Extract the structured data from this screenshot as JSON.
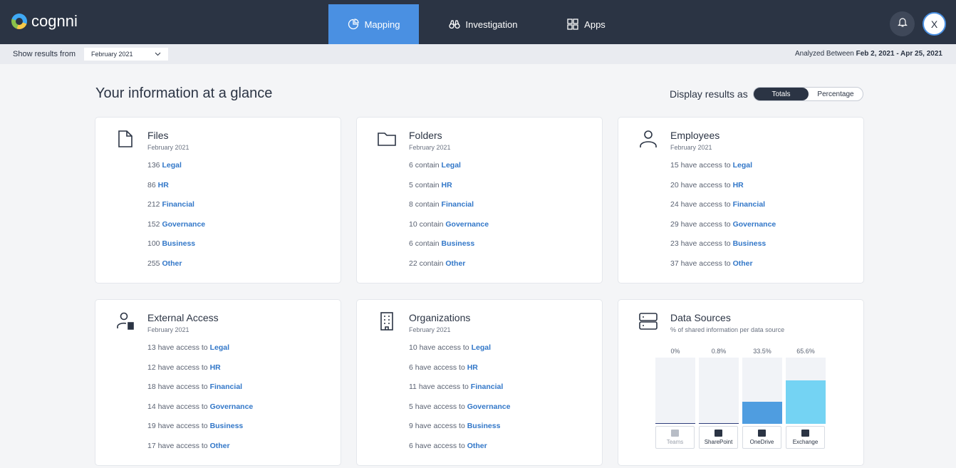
{
  "header": {
    "logo_text": "cognni",
    "nav": [
      {
        "label": "Mapping",
        "active": true
      },
      {
        "label": "Investigation",
        "active": false
      },
      {
        "label": "Apps",
        "active": false
      }
    ],
    "avatar_initial": "X"
  },
  "subbar": {
    "show_results_label": "Show results from",
    "date_select_value": "February 2021",
    "analyzed_prefix": "Analyzed Between",
    "analyzed_range": "Feb 2, 2021 - Apr 25, 2021"
  },
  "main": {
    "title": "Your information at a glance",
    "display_label": "Display results as",
    "toggle": {
      "totals": "Totals",
      "percentage": "Percentage",
      "selected": "Totals"
    }
  },
  "cards": {
    "files": {
      "title": "Files",
      "sub": "February 2021",
      "rows": [
        {
          "prefix": "136 ",
          "cat": "Legal"
        },
        {
          "prefix": "86 ",
          "cat": "HR"
        },
        {
          "prefix": "212 ",
          "cat": "Financial"
        },
        {
          "prefix": "152 ",
          "cat": "Governance"
        },
        {
          "prefix": "100 ",
          "cat": "Business"
        },
        {
          "prefix": "255 ",
          "cat": "Other"
        }
      ]
    },
    "folders": {
      "title": "Folders",
      "sub": "February 2021",
      "rows": [
        {
          "prefix": "6 contain ",
          "cat": "Legal"
        },
        {
          "prefix": "5 contain ",
          "cat": "HR"
        },
        {
          "prefix": "8 contain ",
          "cat": "Financial"
        },
        {
          "prefix": "10 contain ",
          "cat": "Governance"
        },
        {
          "prefix": "6 contain ",
          "cat": "Business"
        },
        {
          "prefix": "22 contain ",
          "cat": "Other"
        }
      ]
    },
    "employees": {
      "title": "Employees",
      "sub": "February 2021",
      "rows": [
        {
          "prefix": "15 have access to ",
          "cat": "Legal"
        },
        {
          "prefix": "20 have access to ",
          "cat": "HR"
        },
        {
          "prefix": "24 have access to ",
          "cat": "Financial"
        },
        {
          "prefix": "29 have access to ",
          "cat": "Governance"
        },
        {
          "prefix": "23 have access to ",
          "cat": "Business"
        },
        {
          "prefix": "37 have access to ",
          "cat": "Other"
        }
      ]
    },
    "external": {
      "title": "External Access",
      "sub": "February 2021",
      "rows": [
        {
          "prefix": "13 have access to ",
          "cat": "Legal"
        },
        {
          "prefix": "12 have access to ",
          "cat": "HR"
        },
        {
          "prefix": "18 have access to ",
          "cat": "Financial"
        },
        {
          "prefix": "14 have access to ",
          "cat": "Governance"
        },
        {
          "prefix": "19 have access to ",
          "cat": "Business"
        },
        {
          "prefix": "17 have access to ",
          "cat": "Other"
        }
      ]
    },
    "organizations": {
      "title": "Organizations",
      "sub": "February 2021",
      "rows": [
        {
          "prefix": "10 have access to ",
          "cat": "Legal"
        },
        {
          "prefix": "6 have access to ",
          "cat": "HR"
        },
        {
          "prefix": "11 have access to ",
          "cat": "Financial"
        },
        {
          "prefix": "5 have access to ",
          "cat": "Governance"
        },
        {
          "prefix": "9 have access to ",
          "cat": "Business"
        },
        {
          "prefix": "6 have access to ",
          "cat": "Other"
        }
      ]
    },
    "datasources": {
      "title": "Data Sources",
      "sub": "% of shared information per data source",
      "sources": [
        {
          "name": "Teams",
          "percent_label": "0%",
          "value": 0,
          "color": "#2f3e7a",
          "disabled": true
        },
        {
          "name": "SharePoint",
          "percent_label": "0.8%",
          "value": 0.8,
          "color": "#2f3e7a",
          "disabled": false
        },
        {
          "name": "OneDrive",
          "percent_label": "33.5%",
          "value": 33.5,
          "color": "#4f9de0",
          "disabled": false
        },
        {
          "name": "Exchange",
          "percent_label": "65.6%",
          "value": 65.6,
          "color": "#74d3f3",
          "disabled": false
        }
      ]
    }
  },
  "colors": {
    "header_bg": "#2b3444",
    "accent": "#4a90e2",
    "link": "#3277c8"
  }
}
